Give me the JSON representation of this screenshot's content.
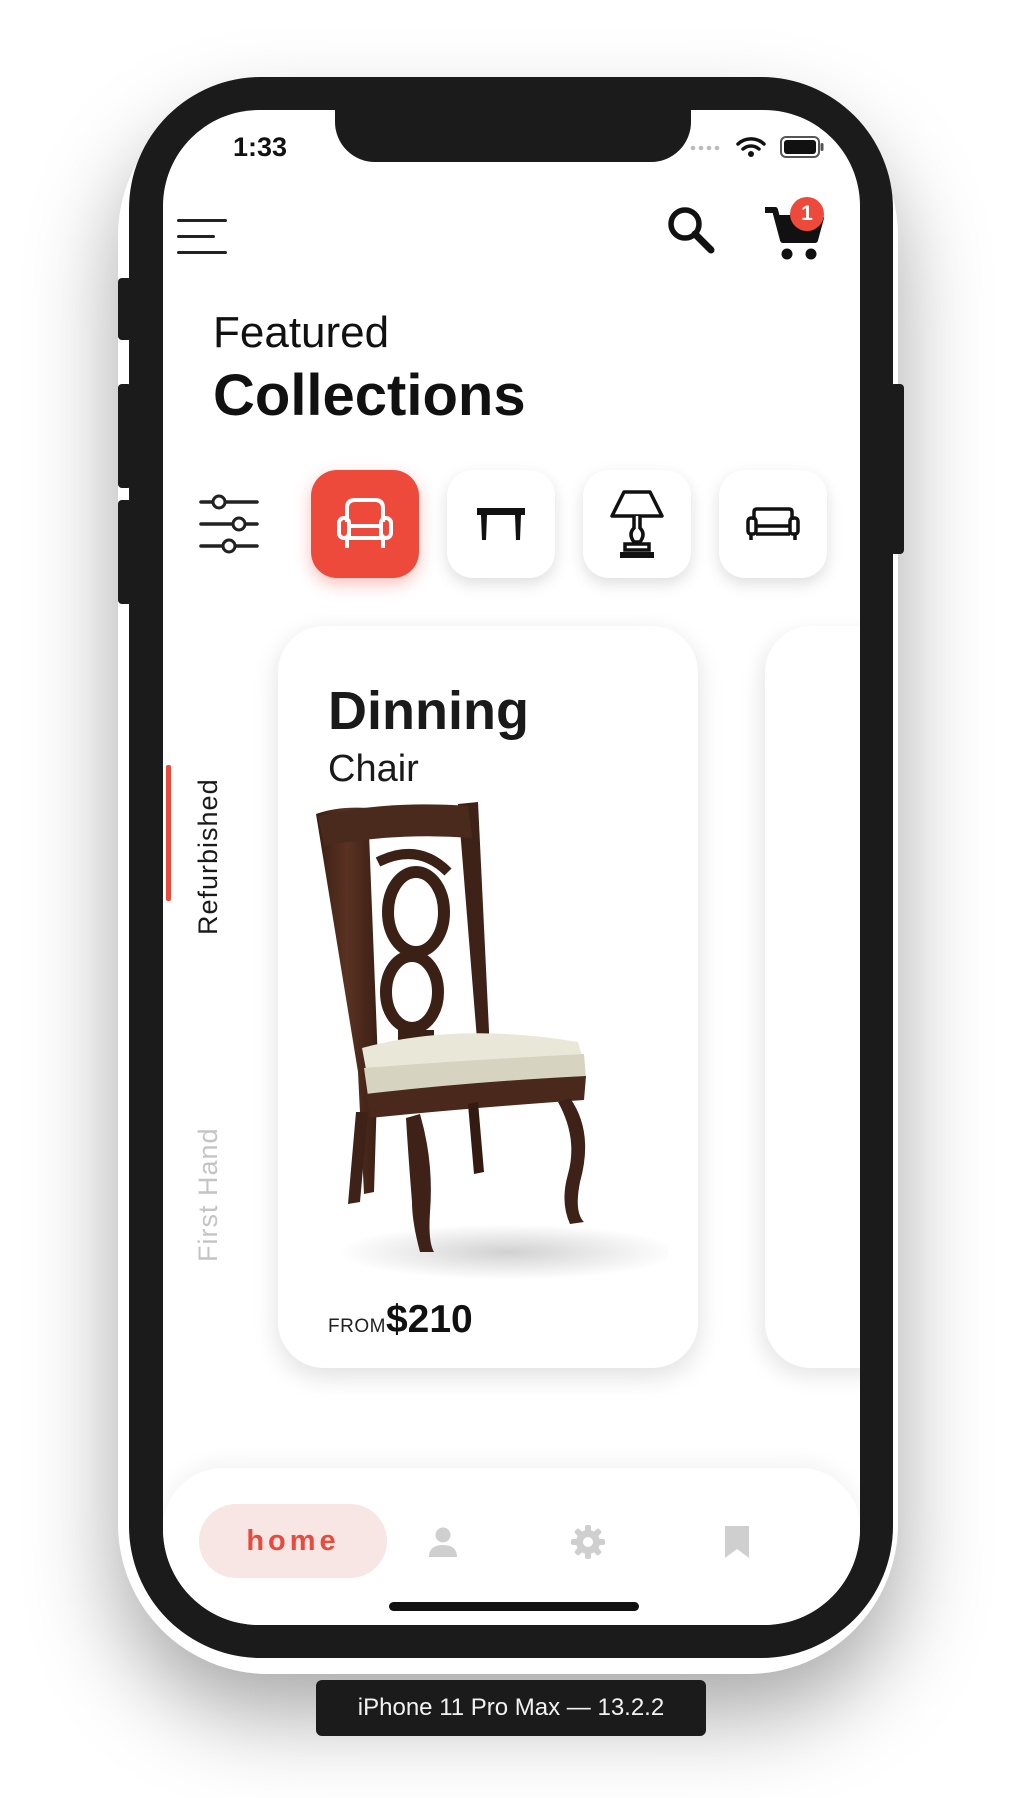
{
  "status_bar": {
    "time": "1:33"
  },
  "header": {
    "cart_count": "1"
  },
  "titles": {
    "featured": "Featured",
    "collections": "Collections"
  },
  "categories": [
    {
      "icon": "armchair-icon",
      "active": true
    },
    {
      "icon": "table-icon",
      "active": false
    },
    {
      "icon": "lamp-icon",
      "active": false
    },
    {
      "icon": "sofa-icon",
      "active": false
    }
  ],
  "vertical_tabs": [
    {
      "label": "Refurbished",
      "active": true
    },
    {
      "label": "First Hand",
      "active": false
    }
  ],
  "product": {
    "title": "Dinning",
    "subtitle": "Chair",
    "price_prefix": "FROM",
    "price": "$210"
  },
  "bottom_nav": {
    "home_label": "home",
    "items": [
      "home",
      "profile-icon",
      "settings-icon",
      "bookmark-icon"
    ]
  },
  "device_label": "iPhone 11 Pro Max — 13.2.2",
  "colors": {
    "accent": "#ee4a3c",
    "accent_soft": "#f7e6e3",
    "text": "#111111",
    "muted": "#c4c4c4"
  }
}
